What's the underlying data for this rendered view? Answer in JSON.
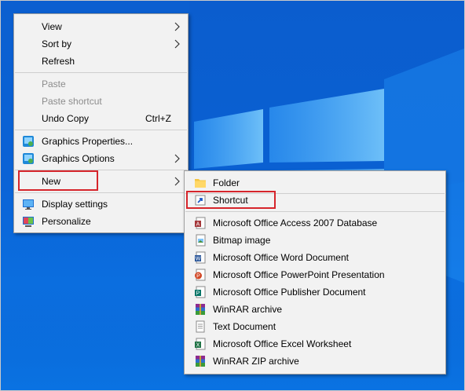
{
  "context_menu": {
    "items": [
      {
        "label": "View",
        "has_submenu": true
      },
      {
        "label": "Sort by",
        "has_submenu": true
      },
      {
        "label": "Refresh"
      },
      {
        "label": "Paste",
        "disabled": true
      },
      {
        "label": "Paste shortcut",
        "disabled": true
      },
      {
        "label": "Undo Copy",
        "shortcut": "Ctrl+Z"
      },
      {
        "label": "Graphics Properties...",
        "icon": "intel-graphics-icon"
      },
      {
        "label": "Graphics Options",
        "icon": "intel-graphics-icon",
        "has_submenu": true
      },
      {
        "label": "New",
        "has_submenu": true,
        "highlighted": true
      },
      {
        "label": "Display settings",
        "icon": "display-settings-icon"
      },
      {
        "label": "Personalize",
        "icon": "personalize-icon"
      }
    ]
  },
  "new_submenu": {
    "items": [
      {
        "label": "Folder",
        "icon": "folder-icon"
      },
      {
        "label": "Shortcut",
        "icon": "shortcut-icon",
        "highlighted": true
      },
      {
        "label": "Microsoft Office Access 2007 Database",
        "icon": "access-database-icon"
      },
      {
        "label": "Bitmap image",
        "icon": "bitmap-image-icon"
      },
      {
        "label": "Microsoft Office Word Document",
        "icon": "word-document-icon"
      },
      {
        "label": "Microsoft Office PowerPoint Presentation",
        "icon": "powerpoint-presentation-icon"
      },
      {
        "label": "Microsoft Office Publisher Document",
        "icon": "publisher-document-icon"
      },
      {
        "label": "WinRAR archive",
        "icon": "winrar-archive-icon"
      },
      {
        "label": "Text Document",
        "icon": "text-document-icon"
      },
      {
        "label": "Microsoft Office Excel Worksheet",
        "icon": "excel-worksheet-icon"
      },
      {
        "label": "WinRAR ZIP archive",
        "icon": "winrar-zip-icon"
      }
    ]
  },
  "colors": {
    "desktop_blue": "#0b63d6",
    "menu_background": "#f2f2f2",
    "disabled_text": "#8c8c8c",
    "highlight_outline": "#d6252b"
  }
}
